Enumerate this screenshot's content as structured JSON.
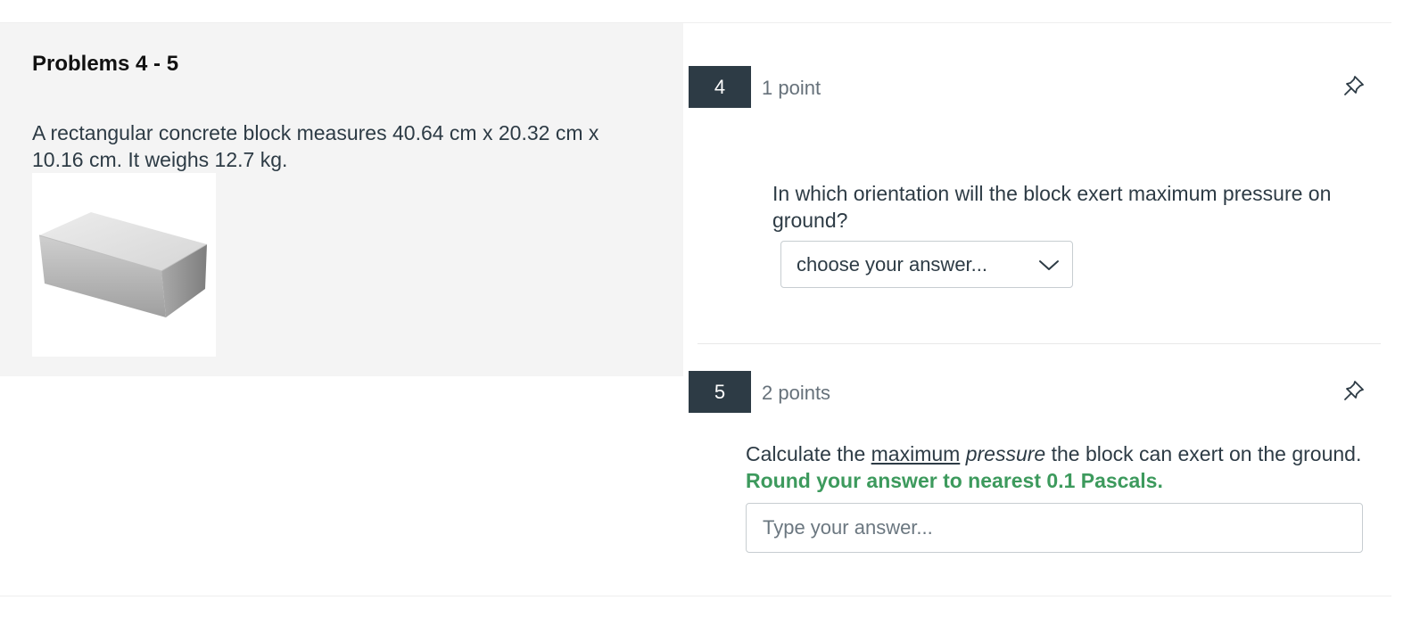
{
  "left": {
    "title": "Problems 4 - 5",
    "text": "A rectangular concrete block measures 40.64 cm x 20.32 cm x 10.16 cm. It weighs 12.7 kg."
  },
  "questions": [
    {
      "number": "4",
      "points": "1 point",
      "prompt": "In which orientation will the block exert maximum pressure on ground?",
      "select_value": "choose your answer..."
    },
    {
      "number": "5",
      "points": "2 points",
      "prompt_parts": {
        "before": "Calculate the ",
        "underlined": "maximum",
        "space": " ",
        "italic": "pressure",
        "after": " the block can exert on the ground.",
        "instruction": "Round your answer to nearest 0.1 Pascals."
      },
      "placeholder": "Type your answer..."
    }
  ],
  "icons": [
    "pin-icon",
    "chevron-down-icon"
  ],
  "colors": {
    "number_badge": "#2d3b45",
    "instruction": "#3d9a5d",
    "left_panel": "#f4f4f4"
  }
}
